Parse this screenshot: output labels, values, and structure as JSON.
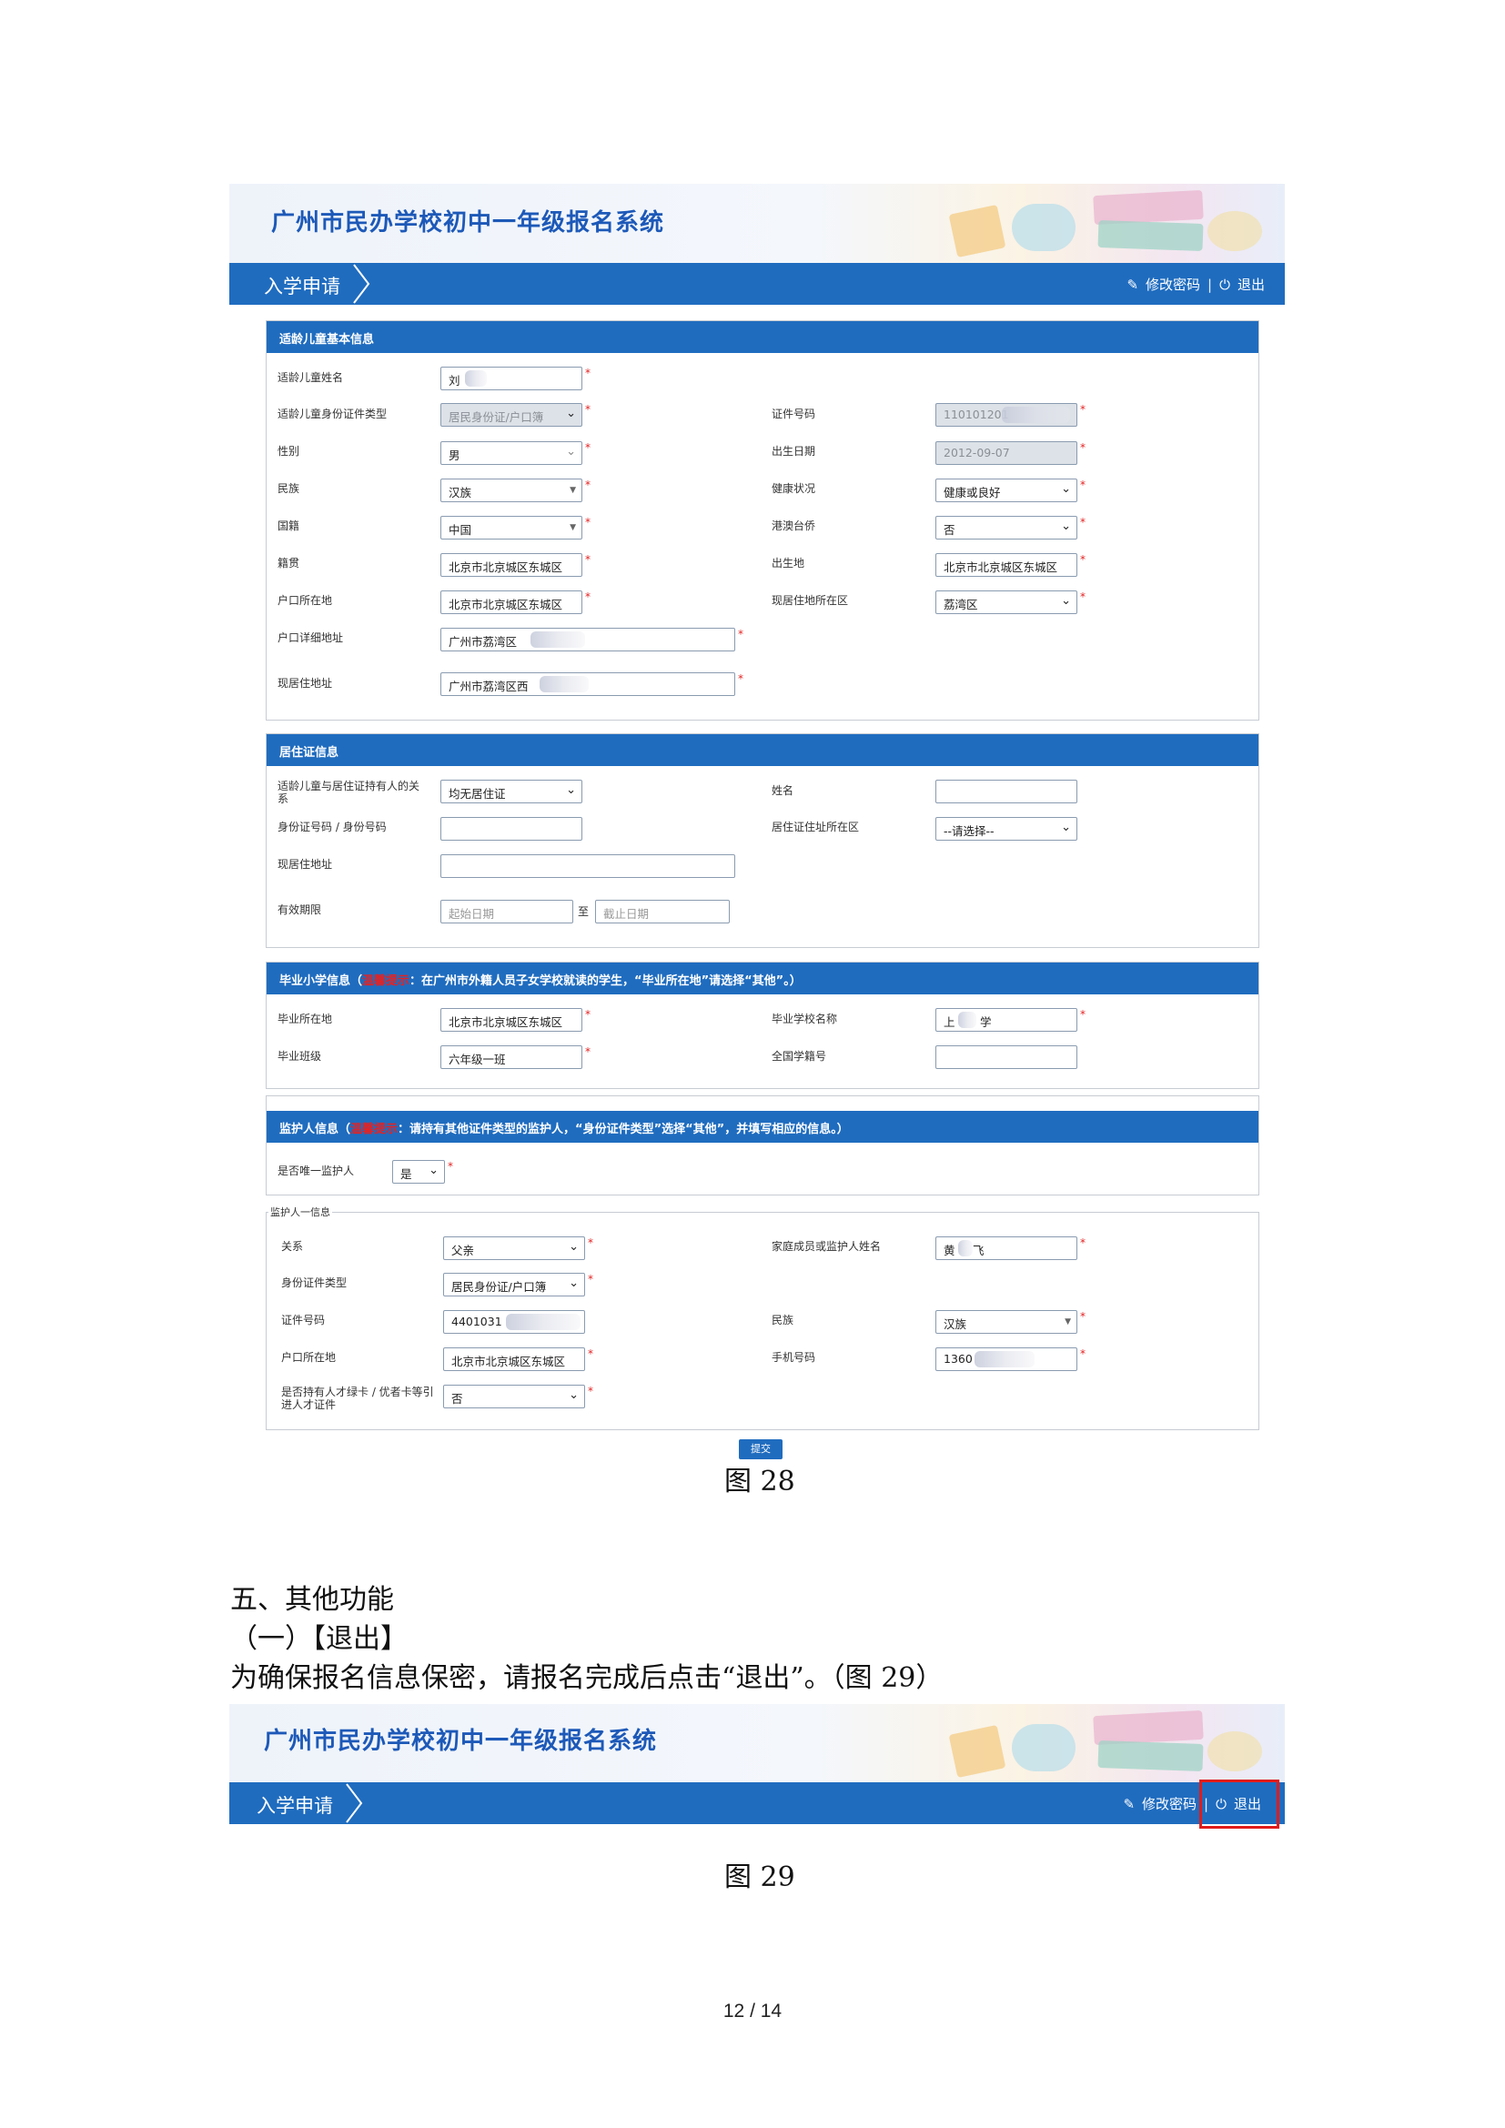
{
  "system_title": "广州市民办学校初中一年级报名系统",
  "nav": {
    "tab": "入学申请",
    "change_password": "修改密码",
    "separator": "|",
    "logout": "退出"
  },
  "child_info": {
    "header": "适龄儿童基本信息",
    "name_label": "适龄儿童姓名",
    "name_value": "刘",
    "id_type_label": "适龄儿童身份证件类型",
    "id_type_value": "居民身份证/户口簿",
    "id_no_label": "证件号码",
    "id_no_value": "110101201",
    "gender_label": "性别",
    "gender_value": "男",
    "birth_label": "出生日期",
    "birth_value": "2012-09-07",
    "ethnic_label": "民族",
    "ethnic_value": "汉族",
    "health_label": "健康状况",
    "health_value": "健康或良好",
    "nation_label": "国籍",
    "nation_value": "中国",
    "hmt_label": "港澳台侨",
    "hmt_value": "否",
    "origin_label": "籍贯",
    "origin_value": "北京市北京城区东城区",
    "birthplace_label": "出生地",
    "birthplace_value": "北京市北京城区东城区",
    "hukou_label": "户口所在地",
    "hukou_value": "北京市北京城区东城区",
    "residence_district_label": "现居住地所在区",
    "residence_district_value": "荔湾区",
    "hukou_addr_label": "户口详细地址",
    "hukou_addr_value": "广州市荔湾区",
    "residence_addr_label": "现居住地址",
    "residence_addr_value": "广州市荔湾区西"
  },
  "permit_info": {
    "header": "居住证信息",
    "relation_label": "适龄儿童与居住证持有人的关系",
    "relation_value": "均无居住证",
    "name_label": "姓名",
    "id_label": "身份证号码 / 身份号码",
    "district_label": "居住证住址所在区",
    "district_value": "--请选择--",
    "addr_label": "现居住地址",
    "validity_label": "有效期限",
    "start_placeholder": "起始日期",
    "to": "至",
    "end_placeholder": "截止日期"
  },
  "school_info": {
    "header_prefix": "毕业小学信息（",
    "header_warn": "温馨提示",
    "header_rest": "：在广州市外籍人员子女学校就读的学生，“毕业所在地”请选择“其他”。）",
    "location_label": "毕业所在地",
    "location_value": "北京市北京城区东城区",
    "school_label": "毕业学校名称",
    "school_value": "上",
    "school_value_tail": "学",
    "class_label": "毕业班级",
    "class_value": "六年级一班",
    "student_no_label": "全国学籍号"
  },
  "guardian_info": {
    "header_prefix": "监护人信息（",
    "header_warn": "温馨提示",
    "header_rest": "：请持有其他证件类型的监护人，“身份证件类型”选择“其他”，并填写相应的信息。）",
    "only_label": "是否唯一监护人",
    "only_value": "是",
    "group_legend": "监护人一信息",
    "relation_label": "关系",
    "relation_value": "父亲",
    "member_label": "家庭成员或监护人姓名",
    "member_value": "黄",
    "member_value_tail": "飞",
    "id_type_label": "身份证件类型",
    "id_type_value": "居民身份证/户口簿",
    "id_no_label": "证件号码",
    "id_no_value": "4401031",
    "ethnic_label": "民族",
    "ethnic_value": "汉族",
    "hukou_label": "户口所在地",
    "hukou_value": "北京市北京城区东城区",
    "phone_label": "手机号码",
    "phone_value": "1360",
    "talent_label": "是否持有人才绿卡 / 优者卡等引进人才证件",
    "talent_value": "否"
  },
  "submit": "提交",
  "caption_28": "图 28",
  "section_title": "五、其他功能",
  "subsection_title": "（一）【退出】",
  "paragraph": "为确保报名信息保密，请报名完成后点击“退出”。（图 29）",
  "caption_29": "图 29",
  "page_number": "12 / 14"
}
